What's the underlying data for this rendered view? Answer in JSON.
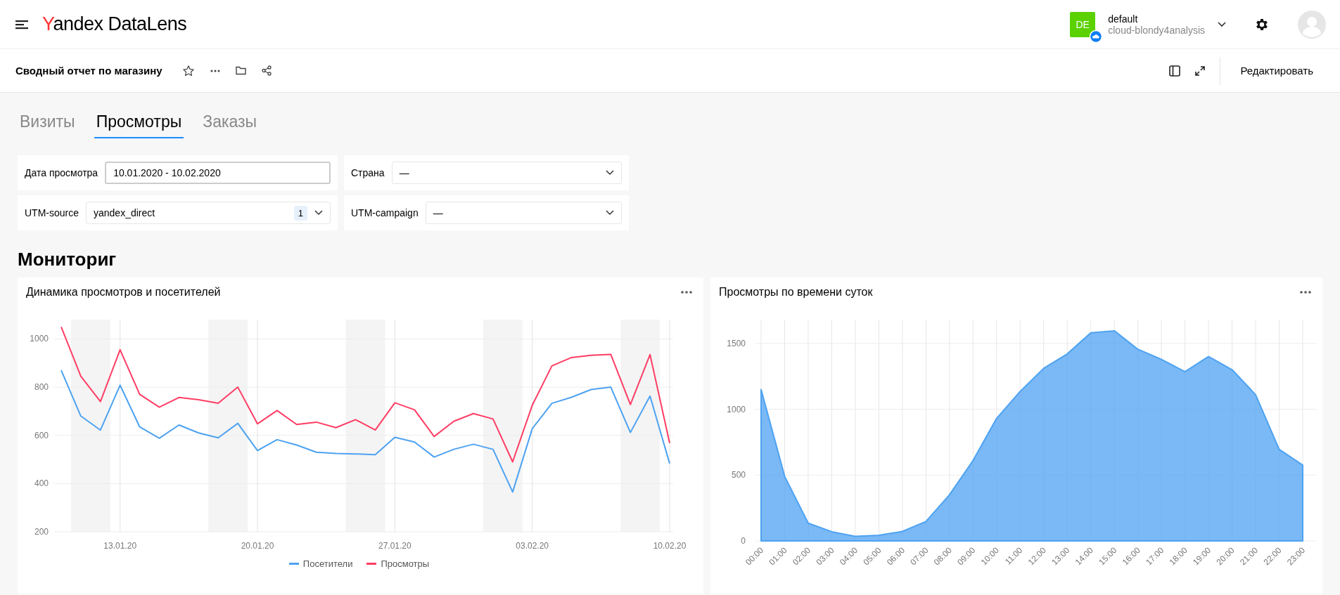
{
  "header": {
    "logo": "Yandex DataLens",
    "account": {
      "initials": "DE",
      "name": "default",
      "cloud": "cloud-blondy4analysis"
    }
  },
  "toolbar": {
    "title": "Сводный отчет по магазину",
    "edit_button": "Редактировать"
  },
  "tabs": [
    {
      "label": "Визиты",
      "selected": false
    },
    {
      "label": "Просмотры",
      "selected": true
    },
    {
      "label": "Заказы",
      "selected": false
    }
  ],
  "filters": [
    {
      "label": "Дата просмотра",
      "kind": "date",
      "value": "10.01.2020 - 10.02.2020"
    },
    {
      "label": "Страна",
      "kind": "select",
      "value": "—"
    },
    {
      "label": "UTM-source",
      "kind": "select",
      "value": "yandex_direct",
      "count": "1"
    },
    {
      "label": "UTM-campaign",
      "kind": "select",
      "value": "—"
    }
  ],
  "section_title": "Мониториг",
  "widgets": [
    {
      "title": "Динамика просмотров и посетителей",
      "chart_data": {
        "type": "line",
        "categories": [
          null,
          null,
          null,
          "13.01.20",
          null,
          null,
          null,
          null,
          null,
          null,
          "20.01.20",
          null,
          null,
          null,
          null,
          null,
          null,
          "27.01.20",
          null,
          null,
          null,
          null,
          null,
          null,
          "03.02.20",
          null,
          null,
          null,
          null,
          null,
          null,
          "10.02.20"
        ],
        "grid": true,
        "series": [
          {
            "name": "Посетители",
            "color": "#4da2f1",
            "values": [
              870,
              680,
              622,
              808,
              635,
              588,
              643,
              610,
              590,
              650,
              537,
              582,
              560,
              530,
              525,
              523,
              520,
              592,
              572,
              510,
              542,
              563,
              542,
              365,
              628,
              733,
              758,
              790,
              800,
              612,
              763,
              483
            ]
          },
          {
            "name": "Просмотры",
            "color": "#ff3d64",
            "values": [
              1050,
              845,
              740,
              955,
              770,
              717,
              757,
              748,
              733,
              800,
              648,
              703,
              645,
              655,
              632,
              665,
              622,
              735,
              706,
              595,
              658,
              690,
              668,
              490,
              725,
              888,
              923,
              932,
              936,
              728,
              935,
              568
            ]
          }
        ],
        "ylim": [
          200,
          1080
        ],
        "yticks": [
          200,
          400,
          600,
          800,
          1000
        ]
      }
    },
    {
      "title": "Просмотры по времени суток",
      "chart_data": {
        "type": "area",
        "categories": [
          "00:00",
          "01:00",
          "02:00",
          "03:00",
          "04:00",
          "05:00",
          "06:00",
          "07:00",
          "08:00",
          "09:00",
          "10:00",
          "11:00",
          "12:00",
          "13:00",
          "14:00",
          "15:00",
          "16:00",
          "17:00",
          "18:00",
          "19:00",
          "20:00",
          "21:00",
          "22:00",
          "23:00"
        ],
        "series": [
          {
            "color": "#4da2f1",
            "values": [
              1150,
              490,
              135,
              70,
              35,
              42,
              72,
              148,
              350,
              610,
              930,
              1135,
              1310,
              1420,
              1580,
              1595,
              1455,
              1378,
              1285,
              1400,
              1300,
              1110,
              695,
              575
            ]
          }
        ],
        "ylim": [
          0,
          1680
        ],
        "yticks": [
          0,
          500,
          1000,
          1500
        ],
        "grid": true
      }
    }
  ]
}
